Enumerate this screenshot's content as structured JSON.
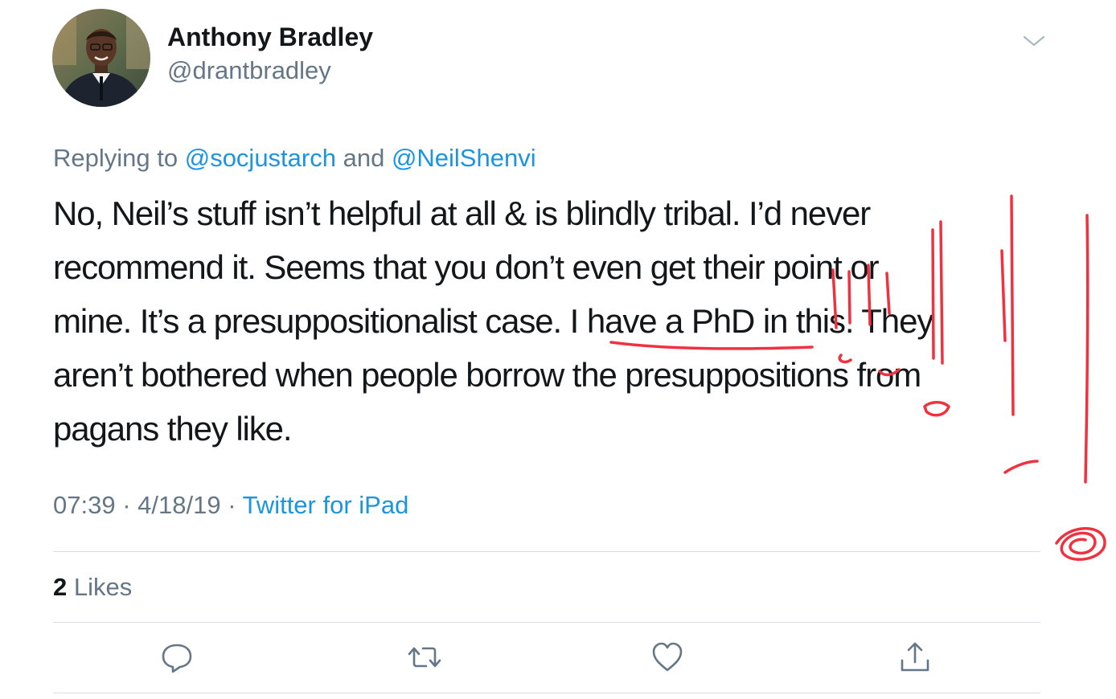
{
  "author": {
    "name": "Anthony Bradley",
    "handle": "@drantbradley"
  },
  "reply": {
    "prefix": "Replying to ",
    "mention1": "@socjustarch",
    "joiner": " and ",
    "mention2": "@NeilShenvi"
  },
  "tweet": {
    "lines": [
      "No, Neil’s stuff isn’t helpful at all & is blindly tribal. I’d never",
      "recommend it. Seems that you don’t even get their point or",
      "mine. It’s a presuppositionalist case. I have a PhD in this. They",
      "aren’t bothered when people borrow the presuppositions from",
      "pagans they like."
    ]
  },
  "meta": {
    "time": "07:39",
    "sep1": " · ",
    "date": "4/18/19",
    "sep2": " · ",
    "source": "Twitter for iPad"
  },
  "likes": {
    "count": "2",
    "label": " Likes"
  },
  "actions": [
    "reply-icon",
    "retweet-icon",
    "like-icon",
    "share-icon"
  ],
  "icons": [
    "chevron-down-icon"
  ],
  "colors": {
    "text": "#14171a",
    "secondary": "#657786",
    "link": "#1b95e0",
    "annotation": "#f0313f"
  }
}
